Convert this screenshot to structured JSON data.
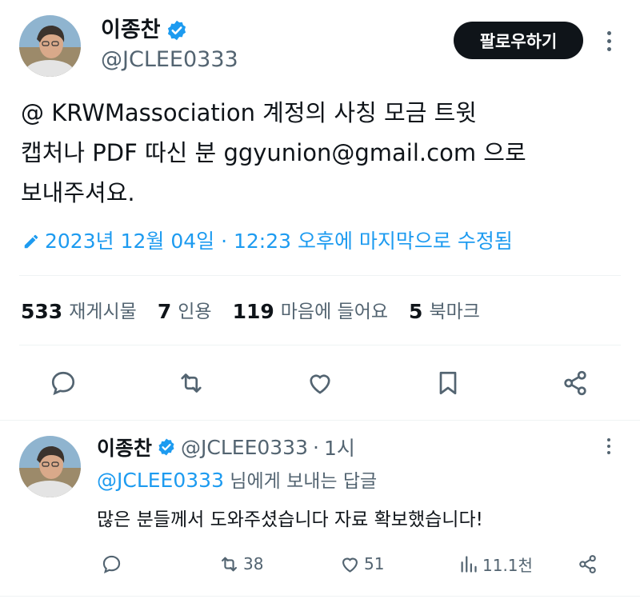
{
  "tweet": {
    "author_name": "이종찬",
    "author_handle": "@JCLEE0333",
    "follow_label": "팔로우하기",
    "text": "@ KRWMassociation 계정의 사칭 모금 트윗\n캡처나 PDF 따신 분 ggyunion@gmail.com 으로\n보내주셔요.",
    "edited": "2023년 12월 04일 · 12:23 오후에 마지막으로 수정됨",
    "stats": [
      {
        "num": "533",
        "label": "재게시물"
      },
      {
        "num": "7",
        "label": "인용"
      },
      {
        "num": "119",
        "label": "마음에 들어요"
      },
      {
        "num": "5",
        "label": "북마크"
      }
    ],
    "actions": [
      "reply-icon",
      "retweet-icon",
      "like-icon",
      "bookmark-icon",
      "share-icon"
    ]
  },
  "reply": {
    "author_name": "이종찬",
    "author_handle": "@JCLEE0333",
    "dot": "·",
    "time": "1시",
    "replying_handle": "@JCLEE0333",
    "replying_suffix": "님에게 보내는 답글",
    "text": "많은 분들께서 도와주셨습니다 자료 확보했습니다!",
    "retweets": "38",
    "likes": "51",
    "views": "11.1천"
  },
  "colors": {
    "accent": "#1d9bf0",
    "text": "#0f1419",
    "muted": "#536471",
    "divider": "#eff3f4"
  }
}
